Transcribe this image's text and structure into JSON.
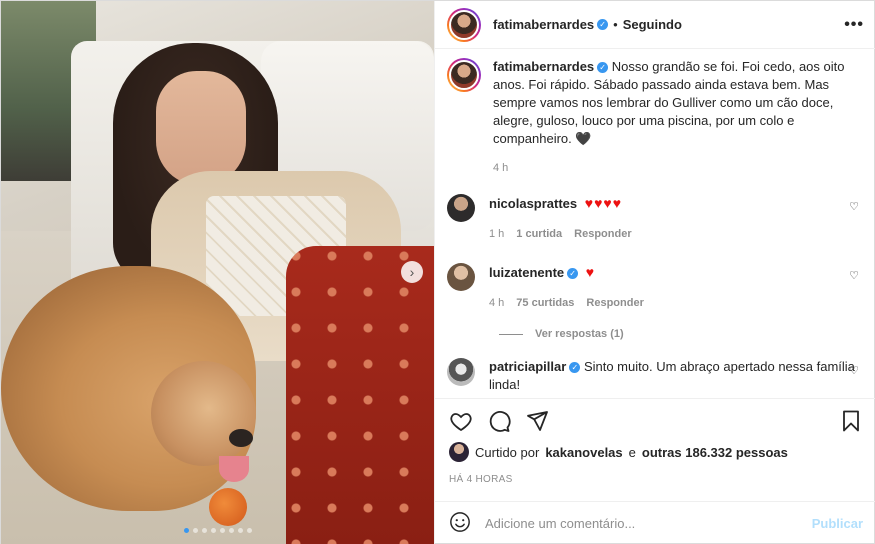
{
  "post": {
    "author": "fatimabernardes",
    "follow_sep": "•",
    "follow_status": "Seguindo",
    "more_icon": "more-horizontal-icon",
    "carousel_dots": 8,
    "carousel_active_index": 0,
    "next_icon": "›"
  },
  "caption": {
    "username": "fatimabernardes",
    "text": "Nosso grandão se foi. Foi cedo, aos oito anos. Foi rápido. Sábado passado ainda estava bem. Mas sempre vamos nos lembrar do Gulliver como um cão doce, alegre, guloso, louco por uma piscina, por um colo e companheiro. 🖤",
    "time": "4 h"
  },
  "comments": [
    {
      "username": "nicolasprattes",
      "verified": false,
      "text": "♥♥♥♥",
      "time": "1 h",
      "likes": "1 curtida",
      "reply": "Responder"
    },
    {
      "username": "luizatenente",
      "verified": true,
      "text": "♥",
      "time": "4 h",
      "likes": "75 curtidas",
      "reply": "Responder"
    },
    {
      "username": "patriciapillar",
      "verified": true,
      "text": "Sinto muito. Um abraço apertado nessa família linda!"
    }
  ],
  "view_replies": "Ver respostas (1)",
  "likes_info": {
    "prefix": "Curtido por",
    "user": "kakanovelas",
    "and": "e",
    "others": "outras 186.332 pessoas"
  },
  "posted_time": "HÁ 4 HORAS",
  "add_comment": {
    "placeholder": "Adicione um comentário...",
    "publish": "Publicar"
  }
}
